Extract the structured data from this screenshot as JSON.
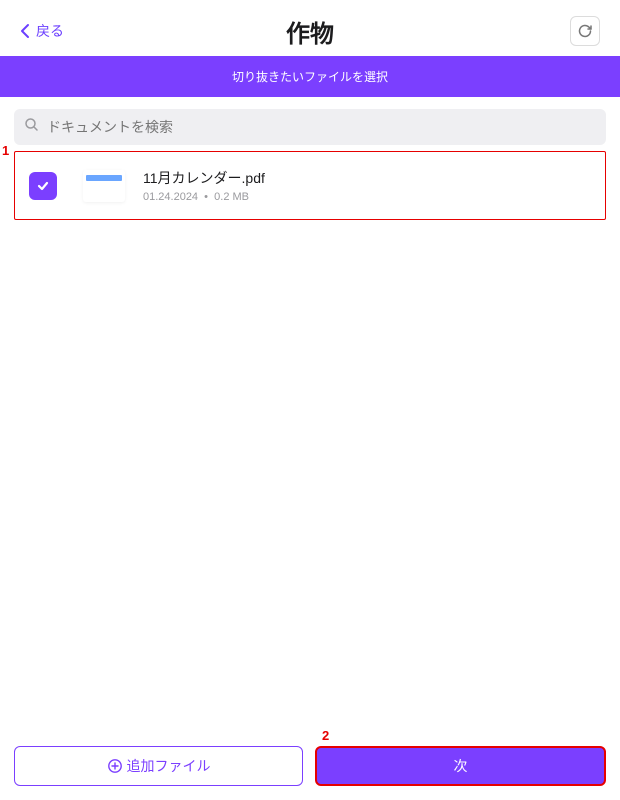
{
  "header": {
    "back_label": "戻る",
    "title": "作物"
  },
  "banner_text": "切り抜きたいファイルを選択",
  "search": {
    "placeholder": "ドキュメントを検索"
  },
  "files": [
    {
      "name": "11月カレンダー.pdf",
      "date": "01.24.2024",
      "size": "0.2 MB",
      "selected": true
    }
  ],
  "buttons": {
    "add_file": "追加ファイル",
    "next": "次"
  },
  "annotations": {
    "label1": "1",
    "label2": "2"
  },
  "colors": {
    "accent": "#7b3fff",
    "annotation": "#e60000"
  }
}
